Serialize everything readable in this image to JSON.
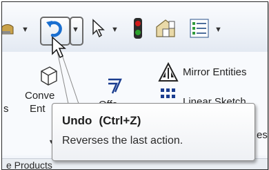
{
  "toolbar": {
    "icons": [
      "mold-icon",
      "undo-icon",
      "select-pointer-icon",
      "traffic-light-icon",
      "file-properties-icon",
      "options-icon"
    ],
    "undo_highlighted": true
  },
  "ribbon": {
    "convert_entities_label_line1": "Conve",
    "convert_entities_label_line2": "Ent",
    "offset_entities_label": "Offs",
    "mirror_entities_label": "Mirror Entities",
    "linear_sketch_label": "Linear Sketch",
    "partial_left_label": "s",
    "partial_right_label": "es"
  },
  "tooltip": {
    "title": "Undo",
    "shortcut": "(Ctrl+Z)",
    "description": "Reverses the last action."
  },
  "bottom_tab": {
    "label": "e Products"
  },
  "colors": {
    "undo_arrow": "#1a6fd0",
    "traffic_red": "#d21a1a",
    "traffic_green": "#2ca02c"
  }
}
